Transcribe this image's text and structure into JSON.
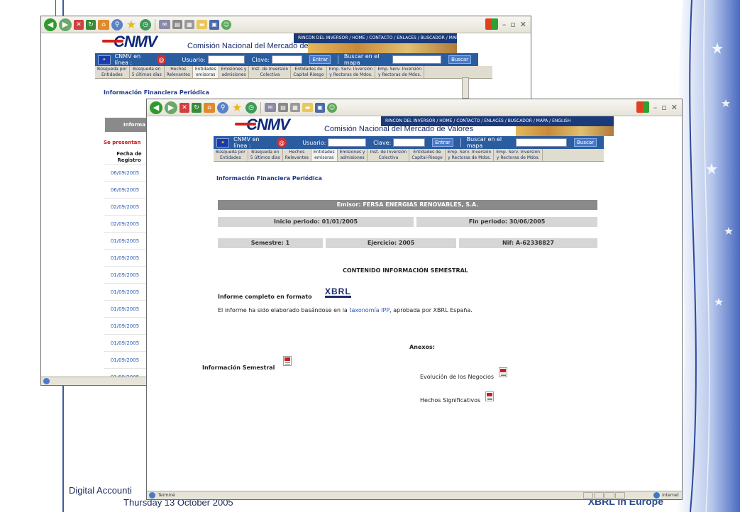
{
  "colors": {
    "cnmv_blue": "#0d2a7a",
    "login_bar": "#2a5ca0",
    "heading_blue": "#1a3a8a",
    "red_text": "#c81a1a",
    "gray_bar": "#d6d6d6",
    "emisor_bar": "#8a8a8a"
  },
  "slide": {
    "footer_line1": "Digital Accounti",
    "footer_line2": "Thursday 13 October 2005",
    "footer_brand": "XBRL in Europe"
  },
  "browser": {
    "toolbar_icons": [
      "back-icon",
      "forward-icon",
      "stop-icon",
      "refresh-icon",
      "home-icon",
      "search-icon",
      "favorites-icon",
      "history-icon",
      "mail-icon",
      "print-icon",
      "edit-icon",
      "folder-icon",
      "messenger-icon",
      "people-icon"
    ],
    "status_text": "Terminé",
    "zone_text": "Internet"
  },
  "site": {
    "logo": "CNMV",
    "full_name": "Comisión Nacional del Mercado de Valores",
    "top_nav": "RINCON DEL INVERSOR / HOME / CONTACTO / ENLACES / BUSCADOR / MAPA / ENGLISH",
    "online_label": "CNMV en línea :",
    "user_label": "Usuario:",
    "password_label": "Clave:",
    "enter_button": "Entrar",
    "map_search_label": "Buscar en el mapa",
    "search_button": "Buscar",
    "menu": [
      {
        "line1": "Búsqueda por",
        "line2": "Entidades"
      },
      {
        "line1": "Búsqueda en",
        "line2": "5 últimos días"
      },
      {
        "line1": "Hechos",
        "line2": "Relevantes"
      },
      {
        "line1": "Entidades",
        "line2": "emisoras"
      },
      {
        "line1": "Emisiones y",
        "line2": "admisiones"
      },
      {
        "line1": "Inst. de Inversión",
        "line2": "Colectiva"
      },
      {
        "line1": "Entidades de",
        "line2": "Capital-Riesgo"
      },
      {
        "line1": "Emp. Serv. Inversión",
        "line2": "y Rectoras de Mdos."
      },
      {
        "line1": "Emp. Serv. Inversión",
        "line2": "y Rectoras de Mdos."
      }
    ]
  },
  "back_page": {
    "heading": "Información Financiera Periódica",
    "table_header": "Informa",
    "red_note": "Se presentan",
    "col_header_line1": "Fecha de",
    "col_header_line2": "Registro",
    "dates": [
      "06/09/2005",
      "06/09/2005",
      "02/09/2005",
      "02/09/2005",
      "01/09/2005",
      "01/09/2005",
      "01/09/2005",
      "01/09/2005",
      "01/09/2005",
      "01/09/2005",
      "01/09/2005",
      "01/09/2005",
      "01/09/2005"
    ]
  },
  "front_page": {
    "heading": "Información Financiera Periódica",
    "emisor": "Emisor: FERSA ENERGIAS RENOVABLES, S.A.",
    "inicio": "Inicio periodo: 01/01/2005",
    "fin": "Fin periodo: 30/06/2005",
    "semestre": "Semestre: 1",
    "ejercicio": "Ejercicio: 2005",
    "nif": "Nif: A-62338827",
    "contenido": "CONTENIDO INFORMACIÓN SEMESTRAL",
    "informe_label": "Informe completo en formato",
    "xbrl_logo": "XBRL",
    "note_before": "El informe ha sido elaborado basándose en la",
    "note_link": "taxonomía IPP",
    "note_after": ", aprobada por XBRL España.",
    "anexos": "Anexos:",
    "info_semestral": "Información Semestral",
    "evolucion": "Evolución de los Negocios",
    "hechos": "Hechos Significativos"
  }
}
